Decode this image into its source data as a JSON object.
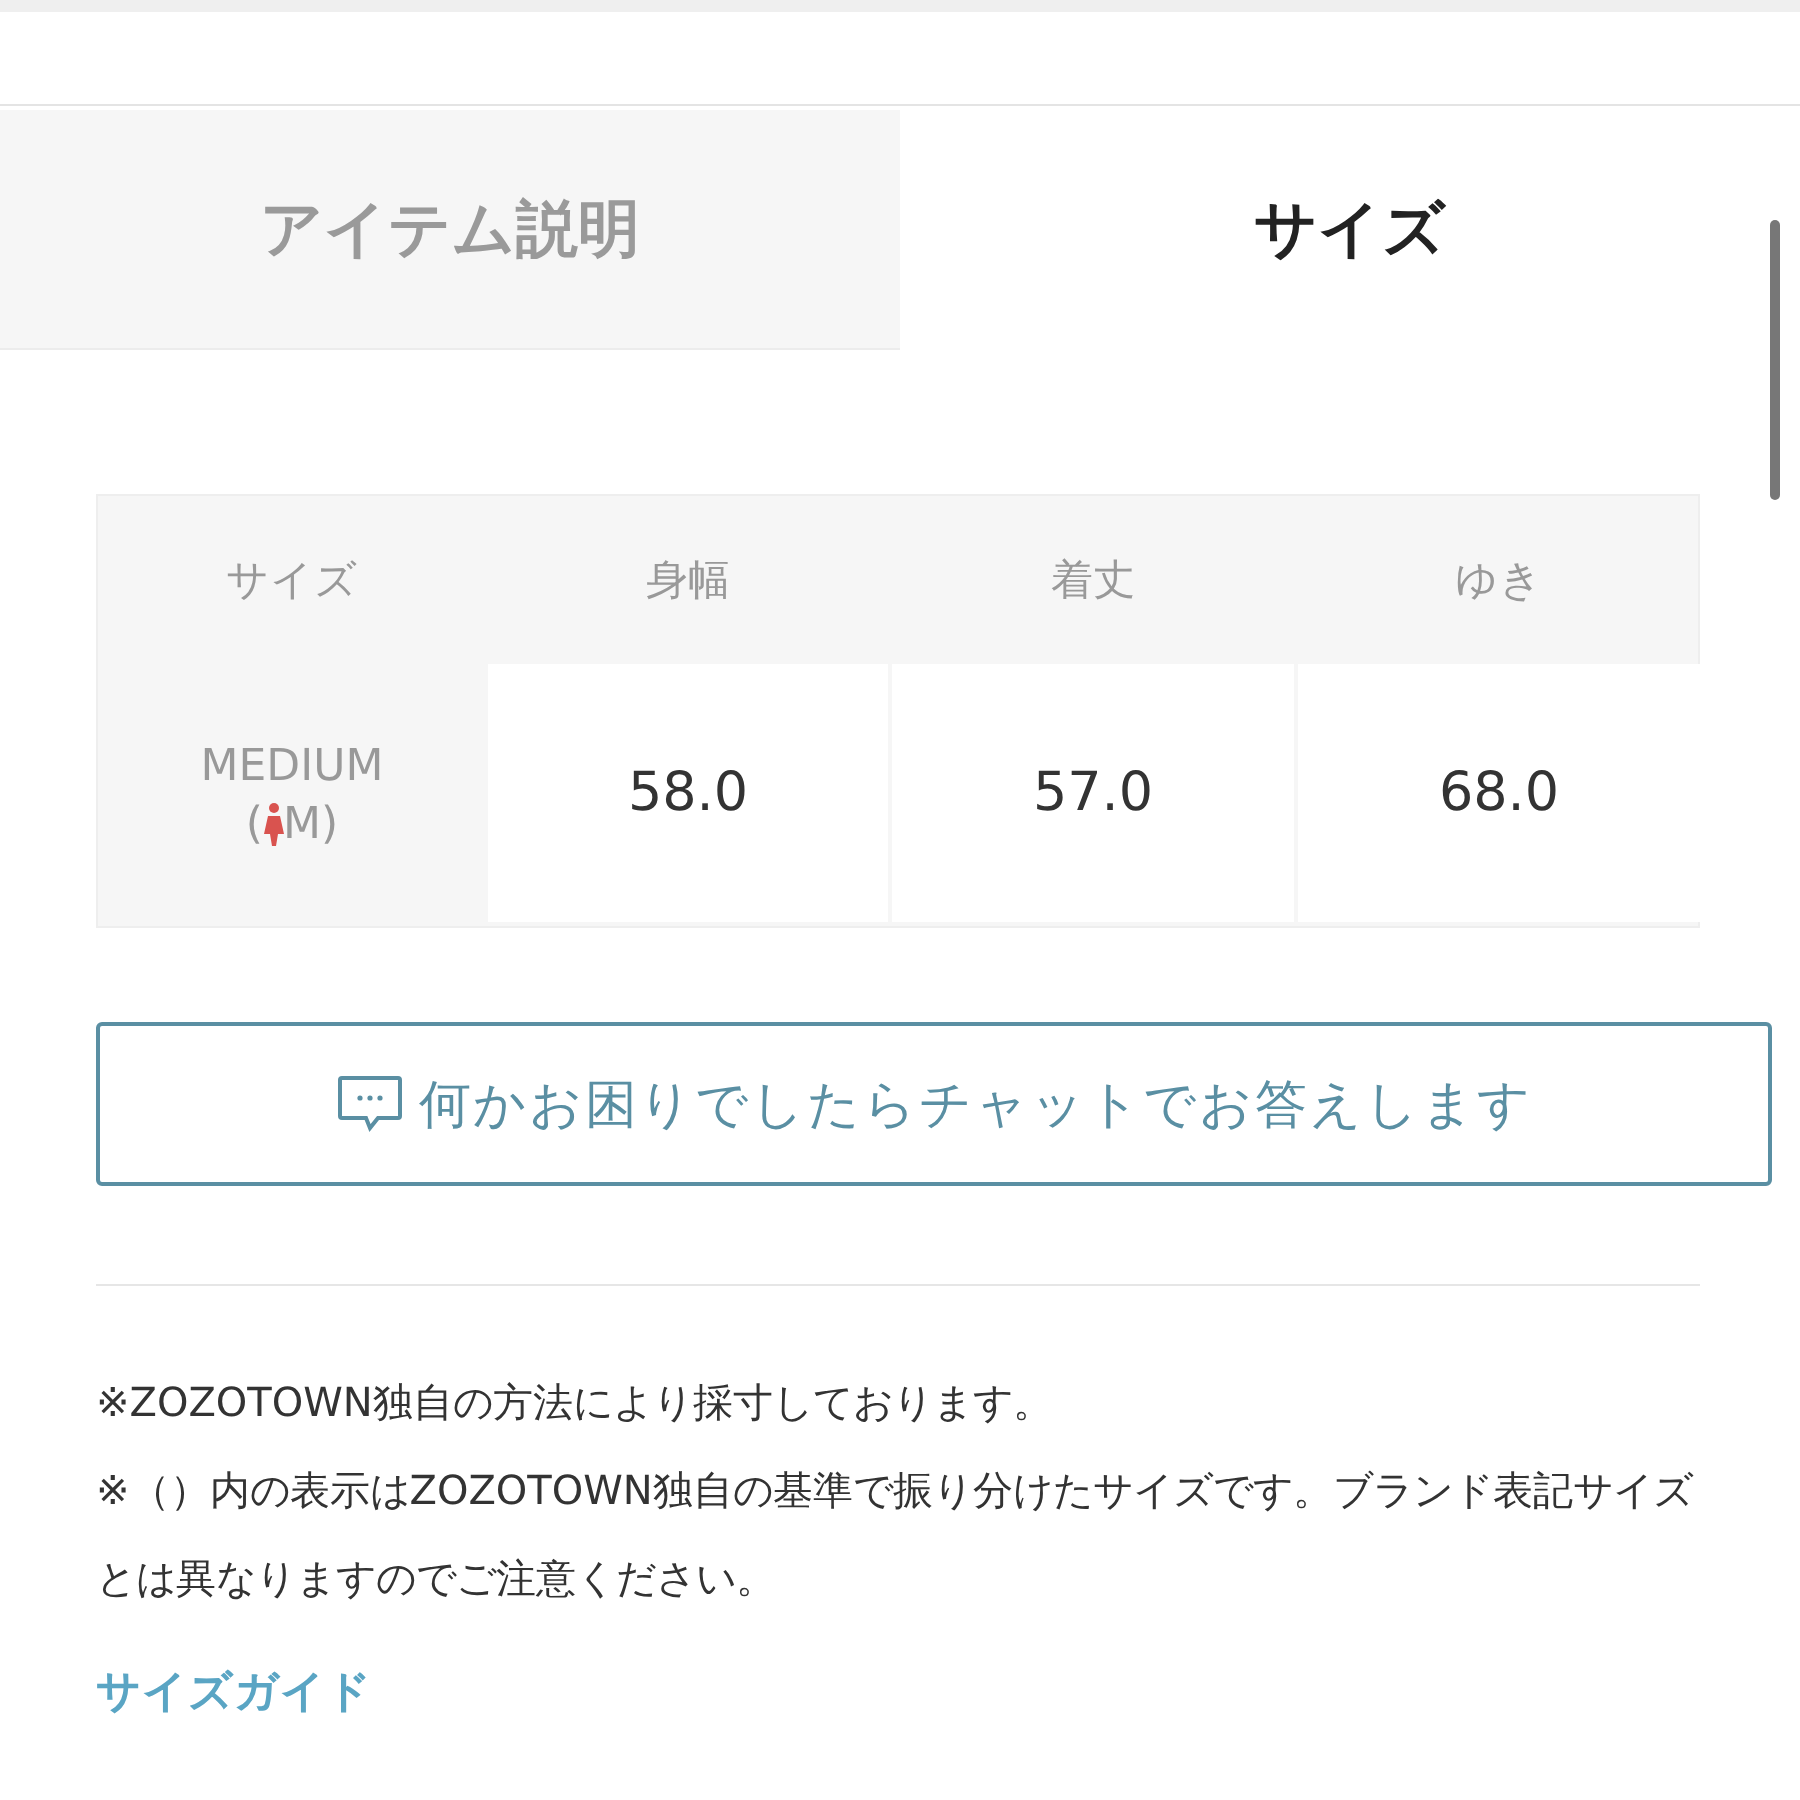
{
  "tabs": [
    {
      "label": "アイテム説明",
      "selected": false
    },
    {
      "label": "サイズ",
      "selected": true
    }
  ],
  "size_table": {
    "columns": [
      "サイズ",
      "身幅",
      "着丈",
      "ゆき"
    ],
    "rows": [
      {
        "size": "MEDIUM",
        "sub_open": "(",
        "sub_rest": "M)",
        "values": [
          "58.0",
          "57.0",
          "68.0"
        ]
      }
    ]
  },
  "chat_button": {
    "label": "何かお困りでしたらチャットでお答えします"
  },
  "notes": [
    "※ZOZOTOWN独自の方法により採寸しております。",
    "※（）内の表示はZOZOTOWN独自の基準で振り分けたサイズです。ブランド表記サイズとは異なりますのでご注意ください。"
  ],
  "size_guide_link": "サイズガイド"
}
